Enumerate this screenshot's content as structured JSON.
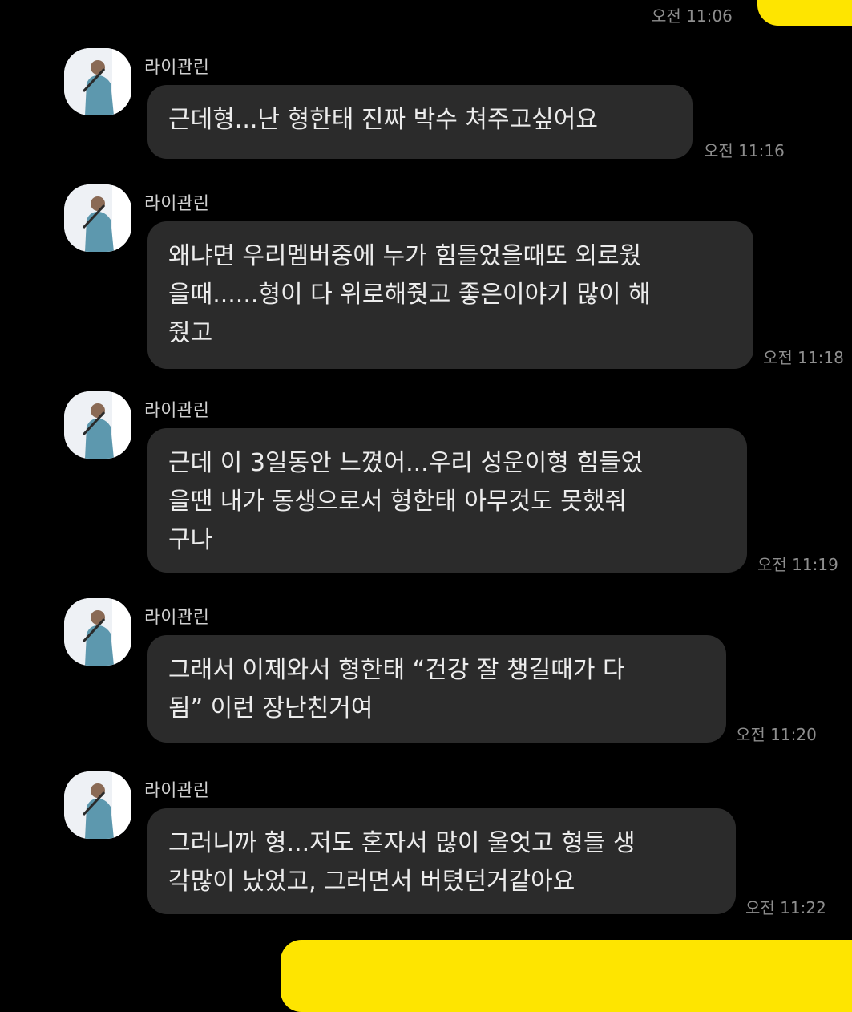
{
  "chat": {
    "top_outgoing_time": "오전 11:06",
    "messages": [
      {
        "sender": "라이관린",
        "text": "근데형...난 형한태 진짜 박수 쳐주고싶어요",
        "time": "오전 11:16"
      },
      {
        "sender": "라이관린",
        "text": "왜냐면 우리멤버중에 누가 힘들었을때또 외로웠\n을때......형이 다 위로해줫고 좋은이야기 많이 해\n줬고",
        "time": "오전 11:18"
      },
      {
        "sender": "라이관린",
        "text": "근데 이 3일동안 느꼈어...우리 성운이형 힘들었\n을땐 내가 동생으로서 형한태 아무것도 못했줘\n구나",
        "time": "오전 11:19"
      },
      {
        "sender": "라이관린",
        "text": "그래서 이제와서 형한태 “건강 잘 챙길때가 다\n됨” 이런 장난친거여",
        "time": "오전 11:20"
      },
      {
        "sender": "라이관린",
        "text": "그러니까 형...저도 혼자서 많이 울엇고 형들 생\n각많이 났었고, 그러면서 버텼던거같아요",
        "time": "오전 11:22"
      }
    ]
  },
  "colors": {
    "background": "#000000",
    "incoming_bubble": "#2b2b2b",
    "outgoing_bubble": "#fee500",
    "timestamp": "#8e8e8e"
  },
  "icons": {
    "avatar": "profile-photo"
  }
}
